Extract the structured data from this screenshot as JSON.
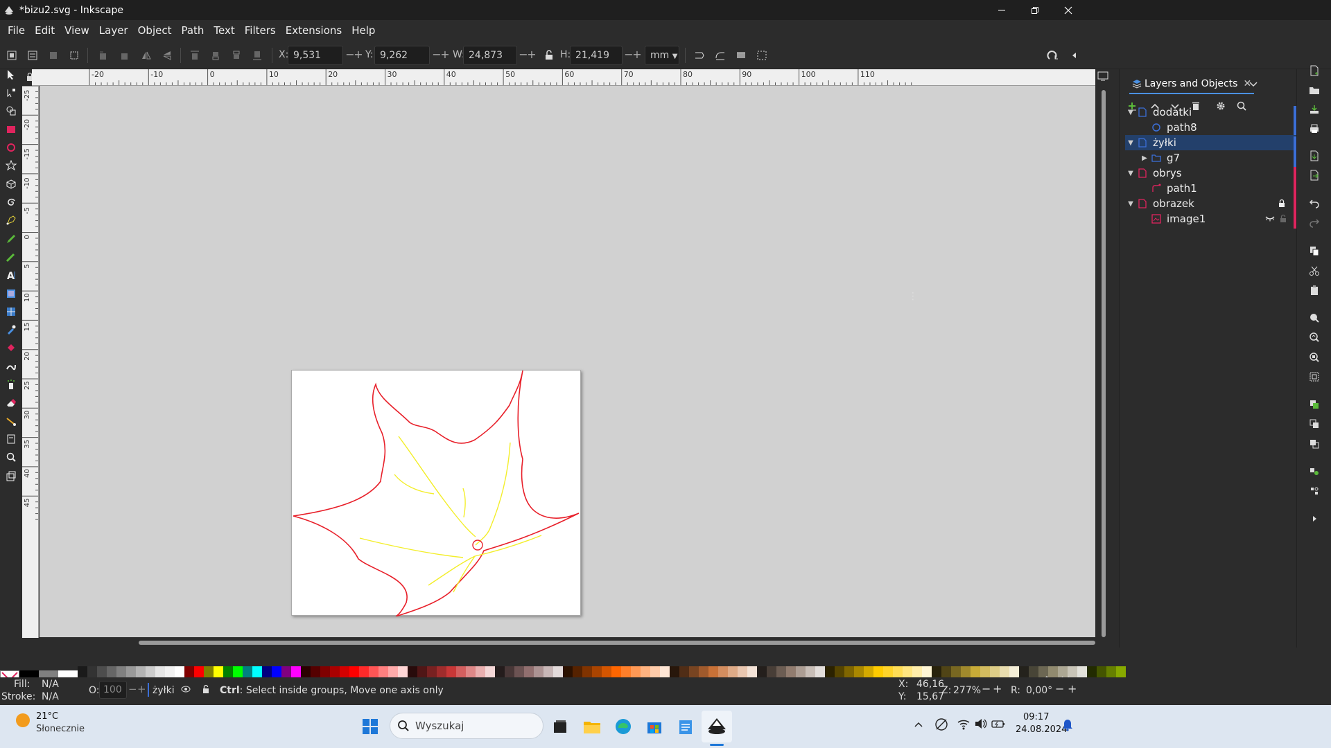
{
  "window": {
    "title": "*bizu2.svg - Inkscape"
  },
  "menu": [
    "File",
    "Edit",
    "View",
    "Layer",
    "Object",
    "Path",
    "Text",
    "Filters",
    "Extensions",
    "Help"
  ],
  "toolctl": {
    "x_label": "X:",
    "x_value": "9,531",
    "y_label": "Y:",
    "y_value": "9,262",
    "w_label": "W:",
    "w_value": "24,873",
    "h_label": "H:",
    "h_value": "21,419",
    "unit": "mm"
  },
  "rulers": {
    "h_labels": [
      "-20",
      "-10",
      "0",
      "10",
      "20",
      "30",
      "40",
      "50",
      "60",
      "70",
      "80",
      "90",
      "100",
      "110"
    ],
    "v_labels": [
      "-25",
      "-20",
      "-15",
      "-10",
      "-5",
      "0",
      "5",
      "10",
      "15",
      "20",
      "25",
      "30",
      "35",
      "40",
      "45"
    ]
  },
  "dock": {
    "tab_label": "Layers and Objects",
    "layers": [
      {
        "label": "dodatki",
        "kind": "layer",
        "depth": 0,
        "expanded": true,
        "color": "#3b6fd8"
      },
      {
        "label": "path8",
        "kind": "circle",
        "depth": 1,
        "color": "#3b6fd8"
      },
      {
        "label": "żyłki",
        "kind": "layer",
        "depth": 0,
        "expanded": true,
        "selected": true,
        "color": "#3b6fd8"
      },
      {
        "label": "g7",
        "kind": "group",
        "depth": 1,
        "expanded": false,
        "color": "#3b6fd8"
      },
      {
        "label": "obrys",
        "kind": "layer",
        "depth": 0,
        "expanded": true,
        "color": "#e0245e"
      },
      {
        "label": "path1",
        "kind": "path",
        "depth": 1,
        "color": "#e0245e"
      },
      {
        "label": "obrazek",
        "kind": "layer",
        "depth": 0,
        "expanded": true,
        "locked": true,
        "color": "#e0245e"
      },
      {
        "label": "image1",
        "kind": "image",
        "depth": 1,
        "hidden": true,
        "color": "#e0245e"
      }
    ]
  },
  "status": {
    "fill_label": "Fill:",
    "fill_value": "N/A",
    "stroke_label": "Stroke:",
    "stroke_value": "N/A",
    "opacity_label": "O:",
    "opacity_value": "100",
    "layer_name": "żyłki",
    "message_bold": "Ctrl",
    "message_rest": ": Select inside groups, Move one axis only",
    "x_label": "X:",
    "x_value": "46,16",
    "y_label": "Y:",
    "y_value": "15,67",
    "zoom_label": "Z:",
    "zoom_value": "277%",
    "rot_label": "R:",
    "rot_value": "0,00°"
  },
  "taskbar": {
    "weather_temp": "21°C",
    "weather_desc": "Słonecznie",
    "search_placeholder": "Wyszukaj",
    "time": "09:17",
    "date": "24.08.2024"
  },
  "colors": {
    "outline": "#e8202a",
    "veins": "#f3ee2a",
    "accent": "#4a90e2"
  }
}
